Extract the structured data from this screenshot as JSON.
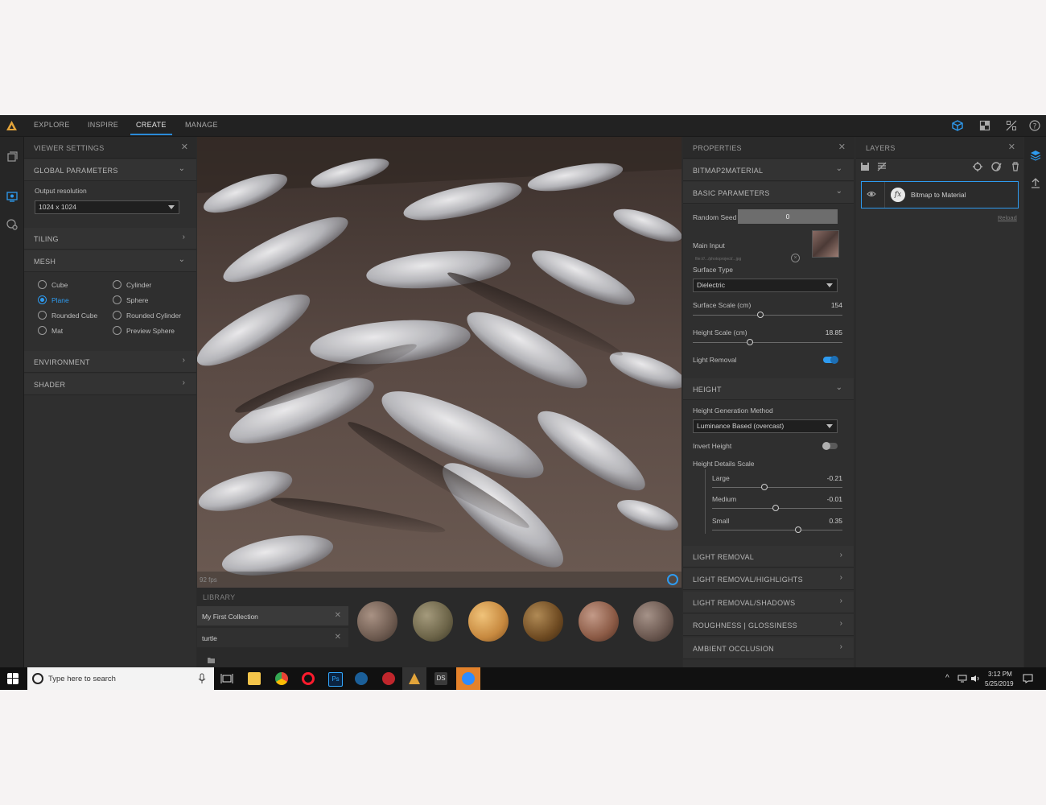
{
  "nav": {
    "tabs": [
      "EXPLORE",
      "INSPIRE",
      "CREATE",
      "MANAGE"
    ],
    "active": "CREATE"
  },
  "viewer": {
    "title": "VIEWER SETTINGS",
    "global_label": "GLOBAL PARAMETERS",
    "output_res_label": "Output resolution",
    "output_res_value": "1024 x 1024",
    "tiling_label": "TILING",
    "mesh_label": "MESH",
    "mesh_options": [
      "Cube",
      "Cylinder",
      "Plane",
      "Sphere",
      "Rounded Cube",
      "Rounded Cylinder",
      "Mat",
      "Preview Sphere"
    ],
    "mesh_selected": "Plane",
    "environment_label": "ENVIRONMENT",
    "shader_label": "SHADER"
  },
  "viewport": {
    "fps": "92 fps"
  },
  "library": {
    "label": "LIBRARY",
    "collections": [
      "My First Collection",
      "turtle"
    ]
  },
  "properties": {
    "title": "PROPERTIES",
    "section_b2m": "BITMAP2MATERIAL",
    "section_basic": "BASIC PARAMETERS",
    "random_seed_label": "Random Seed",
    "random_seed_value": "0",
    "main_input_label": "Main Input",
    "main_input_path": "file:///.../photoproject/...jpg",
    "surface_type_label": "Surface Type",
    "surface_type_value": "Dielectric",
    "surface_scale_label": "Surface Scale (cm)",
    "surface_scale_value": "154",
    "surface_scale_level": 0.45,
    "height_scale_label": "Height Scale (cm)",
    "height_scale_value": "18.85",
    "height_scale_level": 0.38,
    "light_removal_label": "Light Removal",
    "light_removal_on": true,
    "section_height": "HEIGHT",
    "height_gen_label": "Height Generation Method",
    "height_gen_value": "Luminance Based (overcast)",
    "invert_height_label": "Invert Height",
    "invert_height_on": false,
    "height_details_label": "Height Details Scale",
    "details": [
      {
        "label": "Large",
        "value": "-0.21",
        "level": 0.4
      },
      {
        "label": "Medium",
        "value": "-0.01",
        "level": 0.49
      },
      {
        "label": "Small",
        "value": "0.35",
        "level": 0.66
      }
    ],
    "collapsed_sections": [
      "LIGHT REMOVAL",
      "LIGHT REMOVAL/HIGHLIGHTS",
      "LIGHT REMOVAL/SHADOWS",
      "ROUGHNESS | GLOSSINESS",
      "AMBIENT OCCLUSION"
    ]
  },
  "layers": {
    "title": "LAYERS",
    "item_label": "Bitmap to Material",
    "reload_label": "Reload"
  },
  "taskbar": {
    "search_placeholder": "Type here to search",
    "time": "3:12 PM",
    "date": "5/25/2019"
  },
  "colors": {
    "accent": "#2e9bf0",
    "panel": "#2f2f2f",
    "app_bg": "#2b2b2b"
  }
}
